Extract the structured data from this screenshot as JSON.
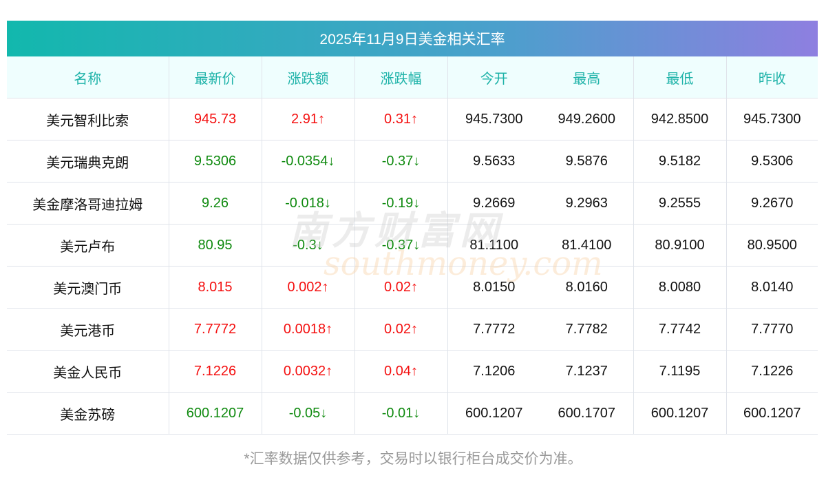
{
  "title": "2025年11月9日美金相关汇率",
  "headers": [
    "名称",
    "最新价",
    "涨跌额",
    "涨跌幅",
    "今开",
    "最高",
    "最低",
    "昨收"
  ],
  "rows": [
    {
      "name": "美元智利比索",
      "latest": "945.73",
      "change": "2.91↑",
      "pct": "0.31↑",
      "open": "945.7300",
      "high": "949.2600",
      "low": "942.8500",
      "prev": "945.7300",
      "dir": "up"
    },
    {
      "name": "美元瑞典克朗",
      "latest": "9.5306",
      "change": "-0.0354↓",
      "pct": "-0.37↓",
      "open": "9.5633",
      "high": "9.5876",
      "low": "9.5182",
      "prev": "9.5306",
      "dir": "down"
    },
    {
      "name": "美金摩洛哥迪拉姆",
      "latest": "9.26",
      "change": "-0.018↓",
      "pct": "-0.19↓",
      "open": "9.2669",
      "high": "9.2963",
      "low": "9.2555",
      "prev": "9.2670",
      "dir": "down"
    },
    {
      "name": "美元卢布",
      "latest": "80.95",
      "change": "-0.3↓",
      "pct": "-0.37↓",
      "open": "81.1100",
      "high": "81.4100",
      "low": "80.9100",
      "prev": "80.9500",
      "dir": "down"
    },
    {
      "name": "美元澳门币",
      "latest": "8.015",
      "change": "0.002↑",
      "pct": "0.02↑",
      "open": "8.0150",
      "high": "8.0160",
      "low": "8.0080",
      "prev": "8.0140",
      "dir": "up"
    },
    {
      "name": "美元港币",
      "latest": "7.7772",
      "change": "0.0018↑",
      "pct": "0.02↑",
      "open": "7.7772",
      "high": "7.7782",
      "low": "7.7742",
      "prev": "7.7770",
      "dir": "up"
    },
    {
      "name": "美金人民币",
      "latest": "7.1226",
      "change": "0.0032↑",
      "pct": "0.04↑",
      "open": "7.1206",
      "high": "7.1237",
      "low": "7.1195",
      "prev": "7.1226",
      "dir": "up"
    },
    {
      "name": "美金苏磅",
      "latest": "600.1207",
      "change": "-0.05↓",
      "pct": "-0.01↓",
      "open": "600.1207",
      "high": "600.1707",
      "low": "600.1207",
      "prev": "600.1207",
      "dir": "down"
    }
  ],
  "footer": "*汇率数据仅供参考，交易时以银行柜台成交价为准。",
  "watermark": {
    "cn": "南方财富网",
    "en": "southmoney.com"
  },
  "colors": {
    "up": "#f40f0f",
    "down": "#0f8a0f",
    "header_text": "#1fb3a9"
  }
}
